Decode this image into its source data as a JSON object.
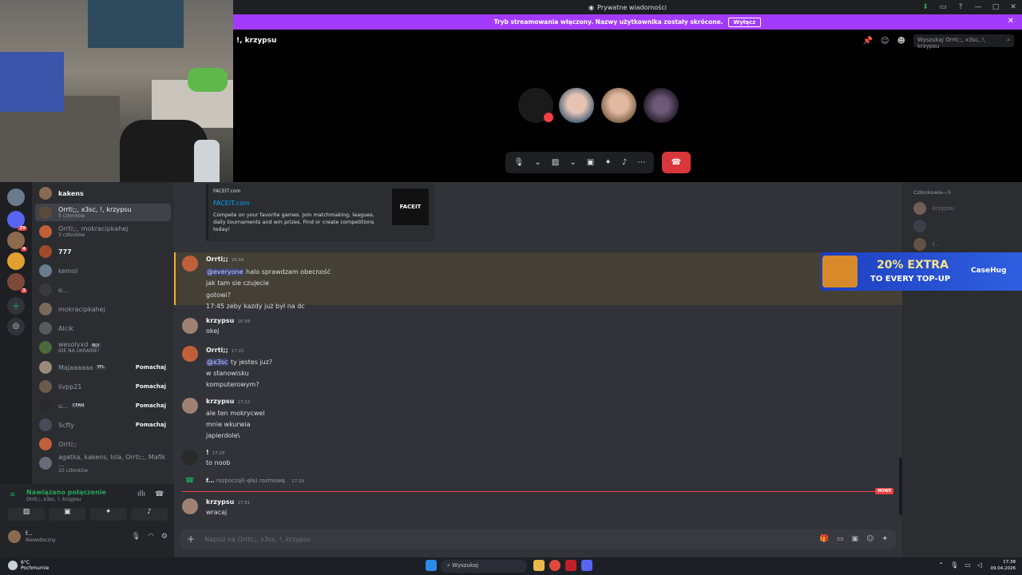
{
  "window": {
    "title": "Prywatne wiadomości",
    "controls": [
      "—",
      "□",
      "✕"
    ]
  },
  "banner": {
    "text": "Tryb streamowania włączony. Nazwy użytkownika zostały skrócone.",
    "button": "Wyłącz"
  },
  "call": {
    "header": "!, krzypsu",
    "search_placeholder": "Wyszukaj Orrti;;, x3sc, !, krzypsu"
  },
  "dm_list": [
    {
      "name": "kakens"
    },
    {
      "name": "Orrti;;, x3sc, !, krzypsu",
      "sub": "5 członków",
      "selected": true
    },
    {
      "name": "Orrti;;, mokracipkahej",
      "sub": "3 członków"
    },
    {
      "name": "777"
    },
    {
      "name": "kemol"
    },
    {
      "name": "o..."
    },
    {
      "name": "mokracipkahej"
    },
    {
      "name": "Alcik"
    },
    {
      "name": "wesolyxd",
      "tag": "BLY",
      "sub": "IDE NA UKRAINE!"
    },
    {
      "name": "Majaaaaaa",
      "tag": "YFL",
      "action": "Pomachaj"
    },
    {
      "name": "livpp21",
      "action": "Pomachaj"
    },
    {
      "name": "u...",
      "tag": "CFAN",
      "action": "Pomachaj"
    },
    {
      "name": "Scfty",
      "action": "Pomachaj"
    },
    {
      "name": "Orrti;;"
    },
    {
      "name": "agatka, kakens, Isla, Orrti;;, Mafik ...",
      "sub": "10 członków"
    }
  ],
  "voice": {
    "status": "Nawiązano połączenie",
    "channel": "Orrti;;, x3sc, !, krzypsu",
    "user": "f...",
    "user_status": "Niewidoczny"
  },
  "embed": {
    "site": "FACEIT.com",
    "title": "FACEIT.com",
    "desc": "Compete on your favorite games. Join matchmaking, leagues, daily tournaments and win prizes. Find or create competitions today!",
    "logo": "FACEIT"
  },
  "messages": [
    {
      "author": "Orrti;;",
      "time": "16:58",
      "lines": [
        "@everyone halo sprawdzam obecność",
        "jak tam sie czujecie",
        "gotowi?",
        "17:45 zeby kazdy już był na dc"
      ]
    },
    {
      "author": "krzypsu",
      "time": "16:58",
      "lines": [
        "okej"
      ]
    },
    {
      "author": "Orrti;;",
      "time": "17:21",
      "lines": [
        "@x3sc ty jestes juz?",
        "w stanowisku",
        "komputerowym?"
      ]
    },
    {
      "author": "krzypsu",
      "time": "17:22",
      "lines": [
        "ale ten mokrycwel",
        "mnie wkurwia",
        "japierdole\\"
      ]
    },
    {
      "author": "!",
      "time": "17:23",
      "lines": [
        "to noob"
      ]
    },
    {
      "author": "krzypsu",
      "time": "17:31",
      "lines": [
        "wracaj"
      ]
    }
  ],
  "system_msg": {
    "author": "f...",
    "text": "rozpoczął(-ęła) rozmowę.",
    "time": "17:29"
  },
  "new_label": "NOWE",
  "composer_placeholder": "Napisz na Orrti;;, x3sc, !, krzypsu",
  "members": {
    "header": "Członkowie—5",
    "items": [
      "krzypsu",
      "",
      "f..."
    ]
  },
  "ad": {
    "line1": "20% EXTRA",
    "line2": "TO EVERY TOP-UP",
    "brand": "CaseHug"
  },
  "taskbar": {
    "weather_temp": "6°C",
    "weather_desc": "Pochmurnie",
    "search": "Wyszukaj",
    "time": "17:38",
    "date": "09.04.2026"
  },
  "colors": {
    "accent": "#a33bff",
    "online": "#23a55a",
    "danger": "#da373c",
    "mention": "#f0b232"
  }
}
